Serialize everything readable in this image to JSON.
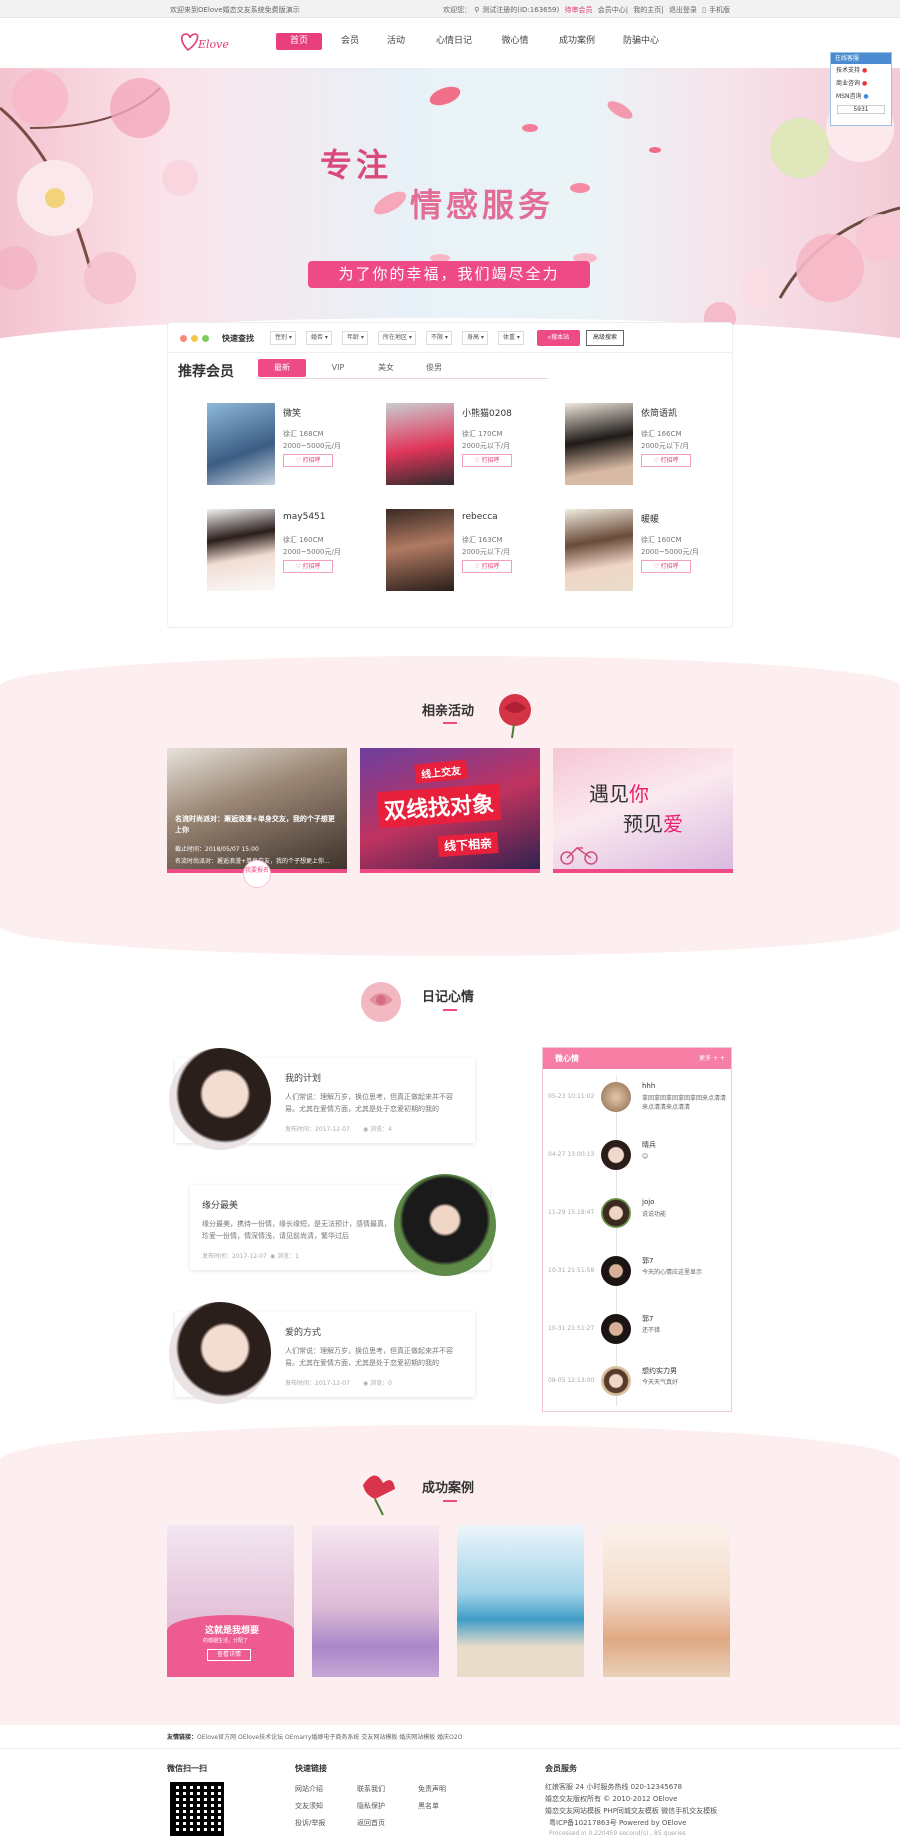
{
  "topbar": {
    "welcome": "欢迎来到OElove婚恋交友系统免费版演示",
    "greeting": "欢迎您：",
    "user": "测试注册的(ID:163659)",
    "upgrade": "待审会员",
    "member_center": "会员中心",
    "my_home": "我的主页",
    "logout": "退出登录",
    "mobile": "手机版"
  },
  "header": {
    "logo_text": "OElove",
    "nav": [
      "首页",
      "会员",
      "活动",
      "心情日记",
      "微心情",
      "成功案例",
      "防骗中心"
    ]
  },
  "online_service": {
    "title": "在线客服",
    "items": [
      "技术支持",
      "商业咨询",
      "MSN咨询"
    ],
    "footer": "5931"
  },
  "hero": {
    "title_line1": "专注",
    "title_line2": "情感服务",
    "slogan": "为了你的幸福，我们竭尽全力"
  },
  "quick_search": {
    "label": "快速查找",
    "filters": [
      "性别",
      "婚否",
      "年龄",
      "所在地区",
      "不限",
      "身高",
      "体重"
    ],
    "search_button": "搜本站",
    "advanced_button": "高级搜索"
  },
  "recommended": {
    "title": "推荐会员",
    "tabs": [
      "最新",
      "VIP",
      "美女",
      "俊男"
    ],
    "say_hi": "打招呼",
    "members": [
      {
        "name": "微笑",
        "info1": "徐汇 168CM",
        "info2": "2000~5000元/月"
      },
      {
        "name": "小熊猫0208",
        "info1": "徐汇 170CM",
        "info2": "2000元以下/月"
      },
      {
        "name": "依简语凯",
        "info1": "徐汇 166CM",
        "info2": "2000元以下/月"
      },
      {
        "name": "may5451",
        "info1": "徐汇 160CM",
        "info2": "2000~5000元/月"
      },
      {
        "name": "rebecca",
        "info1": "徐汇 163CM",
        "info2": "2000元以下/月"
      },
      {
        "name": "暖暖",
        "info1": "徐汇 160CM",
        "info2": "2000~5000元/月"
      }
    ]
  },
  "activities": {
    "title": "相亲活动",
    "card1": {
      "text": "名流时尚派对：邂逅浪漫+单身交友，我的个子想更上你",
      "date": "截止时间：2018/05/07 15:00",
      "sub": "名流时尚派对：邂逅浪漫+单身交友，我的个子想更上你...",
      "badge": "我要报名"
    },
    "card2": {
      "top": "线上交友",
      "main": "双线找对象",
      "bottom": "线下相亲"
    },
    "card3": {
      "line1_a": "遇见",
      "line1_b": "你",
      "line2_a": "预见",
      "line2_b": "爱"
    }
  },
  "diary": {
    "title": "日记心情",
    "entries": [
      {
        "title": "我的计划",
        "text": "人们常说：理解万岁，换位思考，但真正做起来并不容易。尤其在爱情方面，尤其是处于恋爱初期的我的",
        "date": "发布时间：2017-12-07",
        "views": "浏览：4"
      },
      {
        "title": "缘分最美",
        "text": "缘分最美，携待一份情，缘长缘短，是无法预计，感情最真，珍爱一份情，情深情浅，请见前尚清，繁华过后",
        "date": "发布时间：2017-12-07",
        "views": "浏览：1"
      },
      {
        "title": "爱的方式",
        "text": "人们常说：理解万岁，换位思考，但真正做起来并不容易。尤其在爱情方面，尤其是处于恋爱初期的我的",
        "date": "发布时间：2017-12-07",
        "views": "浏览：0"
      }
    ]
  },
  "mood": {
    "title": "微心情",
    "more": "更多 + +",
    "items": [
      {
        "time": "05-23 10:11:02",
        "name": "hhh",
        "msg": "拿回拿回拿回拿回拿回来点清清来点清清来点清清"
      },
      {
        "time": "04-27 13:00:13",
        "name": "晴兵",
        "msg": "😊"
      },
      {
        "time": "11-29 15:18:47",
        "name": "jojo",
        "msg": "说说功能"
      },
      {
        "time": "10-31 21:51:58",
        "name": "郭7",
        "msg": "今天的心情应这里显示"
      },
      {
        "time": "10-31 21:51:27",
        "name": "郭7",
        "msg": "还不错"
      },
      {
        "time": "08-05 12:13:00",
        "name": "想约实力男",
        "msg": "今天天气真好"
      }
    ]
  },
  "success": {
    "title": "成功案例",
    "card1_line1": "这就是我想要",
    "card1_line2": "的婚姻生活，分配了",
    "card1_button": "查看详情"
  },
  "friend_links": {
    "label": "友情链接：",
    "items": "OElove官方网  OElove技术论坛  OEmarry婚嫁电子商务系统  交友网站模板  婚庆网站模板  婚庆O2O"
  },
  "footer": {
    "qr_title": "微信扫一扫",
    "links_title": "快速链接",
    "links": [
      [
        "网站介绍",
        "联系我们",
        "免责声明"
      ],
      [
        "交友须知",
        "隐私保护",
        "黑名单"
      ],
      [
        "投诉/举报",
        "返回首页",
        ""
      ]
    ],
    "service_title": "会员服务",
    "service_lines": [
      "红娘客服      24 小时服务热线 020-12345678",
      "婚恋交友版权所有 © 2010-2012 OElove",
      "婚恋交友网站模板 PHP同城交友模板 微信手机交友模板",
      "粤ICP备10217863号 Powered by OElove",
      "Processed in 0.220459 second(s) , 85 queries"
    ]
  },
  "colors": {
    "accent": "#ee4b86",
    "hero_title": "#d94a7b",
    "soft_bg": "#fdeff0"
  }
}
